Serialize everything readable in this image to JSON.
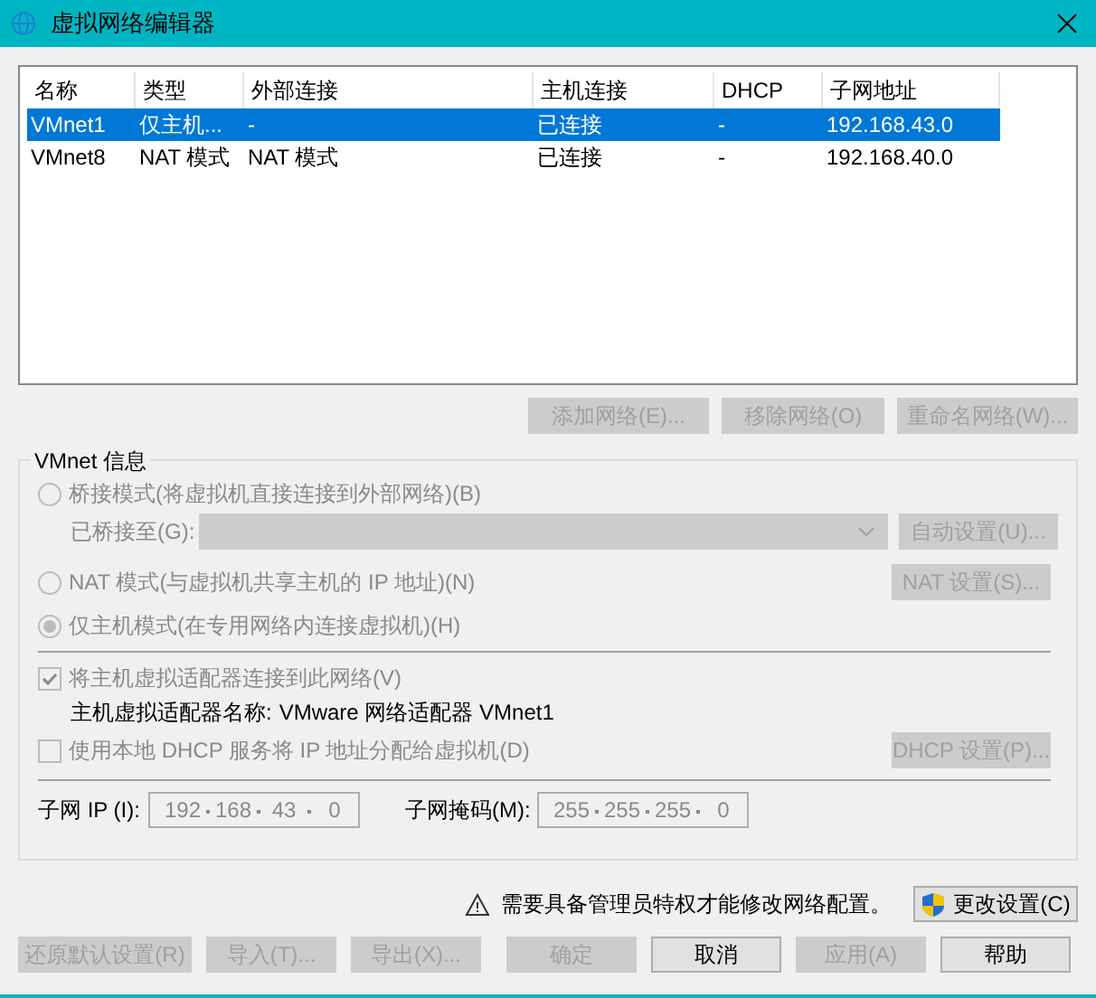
{
  "window": {
    "title": "虚拟网络编辑器"
  },
  "table": {
    "columns": [
      "名称",
      "类型",
      "外部连接",
      "主机连接",
      "DHCP",
      "子网地址"
    ],
    "rows": [
      {
        "cells": [
          "VMnet1",
          "仅主机...",
          "-",
          "已连接",
          "-",
          "192.168.43.0"
        ],
        "selected": true
      },
      {
        "cells": [
          "VMnet8",
          "NAT 模式",
          "NAT 模式",
          "已连接",
          "-",
          "192.168.40.0"
        ],
        "selected": false
      }
    ]
  },
  "network_buttons": [
    {
      "label": "添加网络(E)...",
      "disabled": true
    },
    {
      "label": "移除网络(O)",
      "disabled": true
    },
    {
      "label": "重命名网络(W)...",
      "disabled": true
    }
  ],
  "vmnet_info": {
    "title": "VMnet 信息",
    "bridged": {
      "label": "桥接模式(将虚拟机直接连接到外部网络)(B)",
      "selected": false,
      "disabled": true
    },
    "bridged_to": {
      "label": "已桥接至(G):",
      "disabled": true,
      "button": {
        "label": "自动设置(U)...",
        "disabled": true
      }
    },
    "nat": {
      "label": "NAT 模式(与虚拟机共享主机的 IP 地址)(N)",
      "selected": false,
      "disabled": true,
      "button": {
        "label": "NAT 设置(S)...",
        "disabled": true
      }
    },
    "host_only": {
      "label": "仅主机模式(在专用网络内连接虚拟机)(H)",
      "selected": true,
      "disabled": true
    },
    "connect_adapter": {
      "label": "将主机虚拟适配器连接到此网络(V)",
      "checked": true,
      "disabled": true
    },
    "adapter_name": {
      "label": "主机虚拟适配器名称:",
      "value": "VMware 网络适配器 VMnet1"
    },
    "dhcp": {
      "label": "使用本地 DHCP 服务将 IP 地址分配给虚拟机(D)",
      "checked": false,
      "disabled": true,
      "button": {
        "label": "DHCP 设置(P)...",
        "disabled": true
      }
    },
    "subnet_ip": {
      "label": "子网 IP (I):",
      "octets": [
        "192",
        "168",
        "43",
        "0"
      ]
    },
    "subnet_mask": {
      "label": "子网掩码(M):",
      "octets": [
        "255",
        "255",
        "255",
        "0"
      ]
    }
  },
  "admin_notice": {
    "text": "需要具备管理员特权才能修改网络配置。",
    "button": {
      "label": "更改设置(C)",
      "disabled": false
    }
  },
  "footer_buttons": [
    {
      "label": "还原默认设置(R)",
      "disabled": true
    },
    {
      "label": "导入(T)...",
      "disabled": true
    },
    {
      "label": "导出(X)...",
      "disabled": true
    },
    {
      "label": "确定",
      "disabled": true
    },
    {
      "label": "取消",
      "disabled": false
    },
    {
      "label": "应用(A)",
      "disabled": true
    },
    {
      "label": "帮助",
      "disabled": false
    }
  ]
}
